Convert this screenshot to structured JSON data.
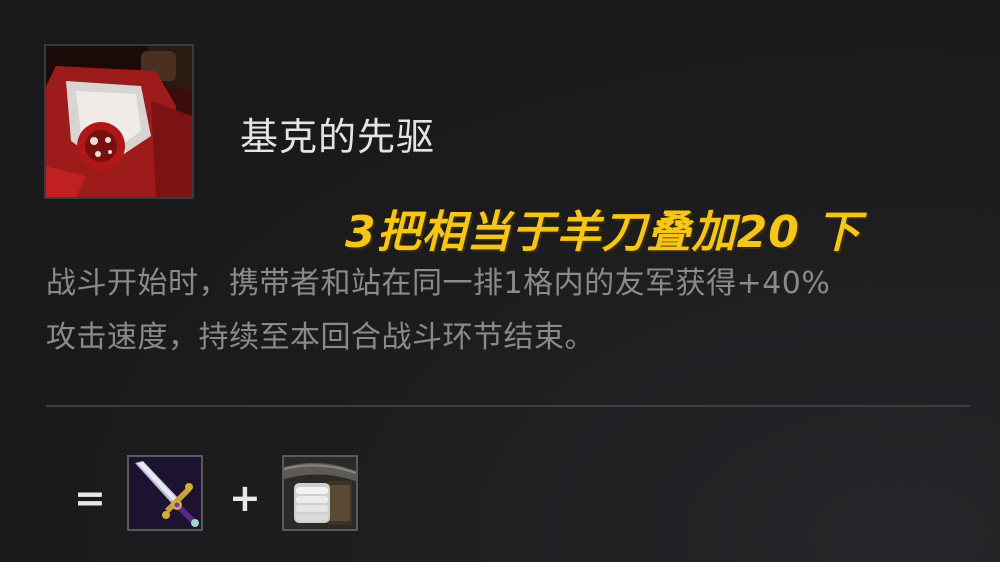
{
  "item": {
    "name": "基克的先驱",
    "icon": "red-banner-icon"
  },
  "annotation": "3把相当于羊刀叠加20 下",
  "description": {
    "line1": "战斗开始时，携带者和站在同一排1格内的友军获得+40%",
    "line2": "攻击速度，持续至本回合战斗环节结束。"
  },
  "recipe": {
    "equals": "=",
    "plus": "+",
    "component1_icon": "recurve-bow-sword-icon",
    "component2_icon": "sparring-gloves-icon"
  },
  "colors": {
    "background": "#1b1b1d",
    "annotation": "#f5c518",
    "title": "#e4e4e4",
    "description": "#8a8a8c"
  }
}
